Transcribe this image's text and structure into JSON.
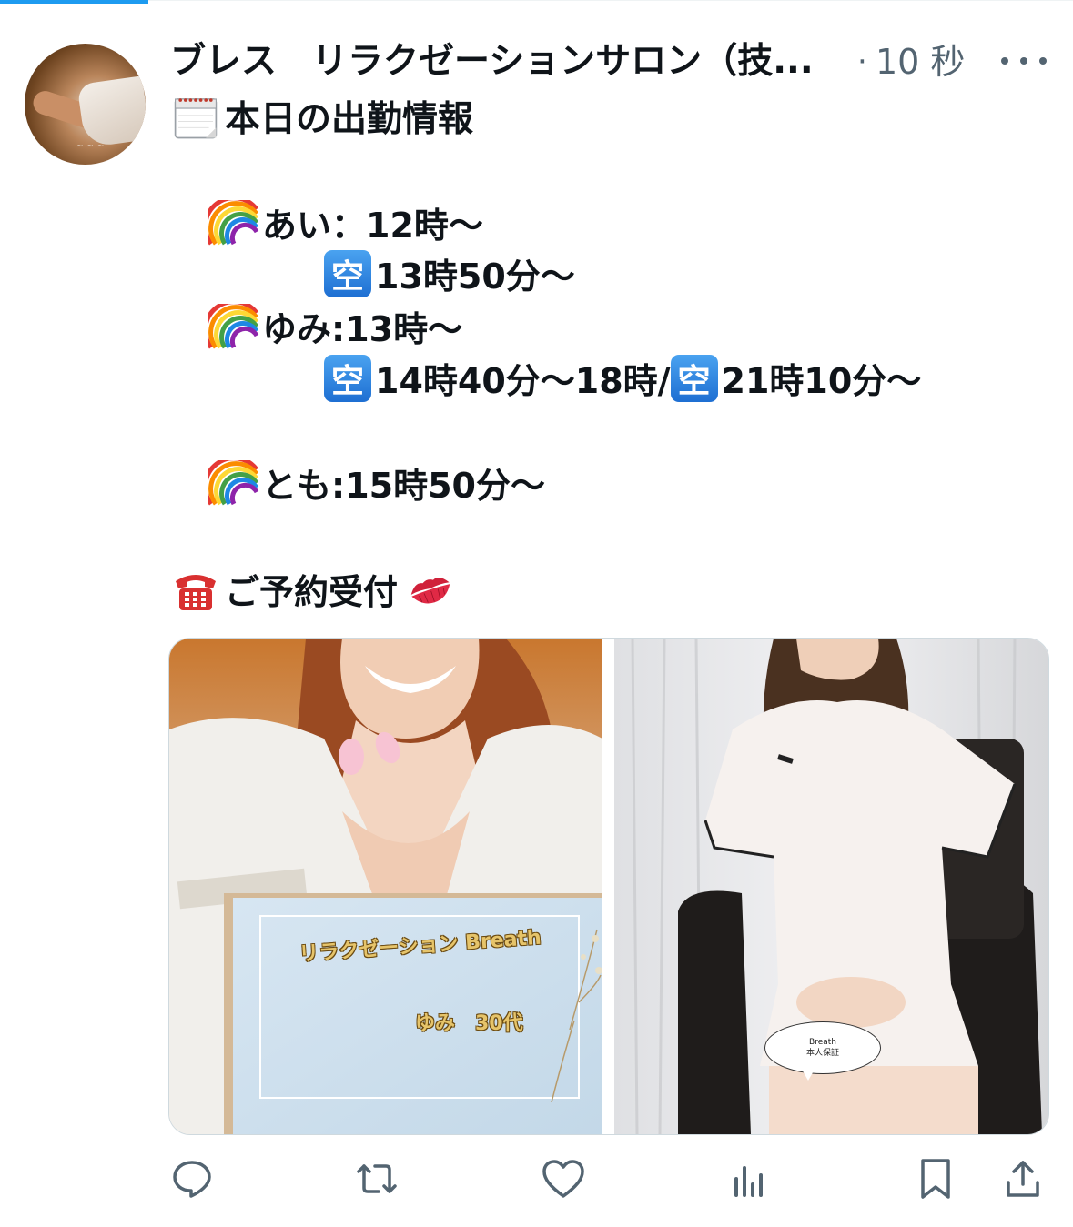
{
  "header": {
    "display_name": "ブレス　リラクゼーションサロン（技...",
    "separator": "·",
    "timestamp": "10 秒"
  },
  "body": {
    "heading_icon": "calendar-icon",
    "heading": "本日の出勤情報",
    "lines": [
      {
        "icon": "rainbow-icon",
        "text": "あい：12時〜"
      },
      {
        "icon": "vacancy-icon",
        "badge": "空",
        "text": "13時50分〜"
      },
      {
        "icon": "rainbow-icon",
        "text": "ゆみ:13時〜"
      },
      {
        "icon": "vacancy-icon",
        "badge": "空",
        "text": "14時40分〜18時/",
        "badge2": "空",
        "text2": "21時10分〜"
      },
      {
        "icon": "rainbow-icon",
        "text": "とも:15時50分〜"
      }
    ],
    "reservation_icon": "telephone-icon",
    "reservation": "ご予約受付",
    "reservation_trailing_icon": "kiss-mark-icon"
  },
  "media": {
    "left_card_title": "リラクゼーション Breath",
    "left_card_sub": "ゆみ　30代",
    "right_bubble_line1": "Breath",
    "right_bubble_line2": "本人保証"
  },
  "actions": [
    "reply-icon",
    "repost-icon",
    "like-icon",
    "views-icon",
    "bookmark-icon",
    "share-icon"
  ],
  "colors": {
    "accent": "#1d9bf0",
    "secondary_text": "#536471",
    "icon_gray": "#536471"
  }
}
